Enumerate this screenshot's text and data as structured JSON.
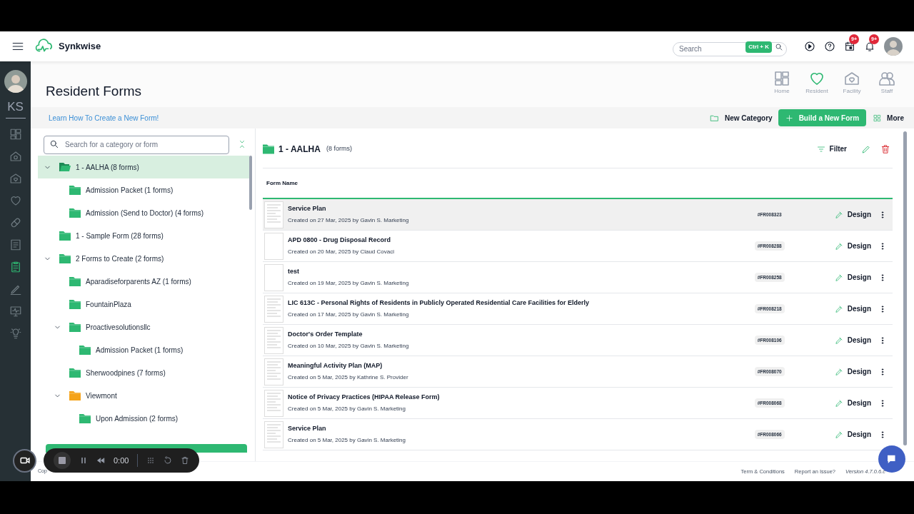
{
  "topbar": {
    "brand": "Synkwise",
    "search": {
      "placeholder": "Search",
      "shortcut": "Ctrl + K"
    },
    "badges": [
      "9+",
      "9+"
    ]
  },
  "side_nav": {
    "initials": "KS",
    "items": [
      {
        "kind": "dashboard",
        "selected": false
      },
      {
        "kind": "facility",
        "selected": false
      },
      {
        "kind": "home",
        "selected": false
      },
      {
        "kind": "heart",
        "selected": false
      },
      {
        "kind": "pill",
        "selected": false
      },
      {
        "kind": "report",
        "selected": false
      },
      {
        "kind": "clipboard",
        "selected": true
      },
      {
        "kind": "pen",
        "selected": false
      },
      {
        "kind": "monitor",
        "selected": false
      },
      {
        "kind": "bulb",
        "selected": false
      }
    ]
  },
  "page": {
    "title": "Resident Forms",
    "learn_link": "Learn How To Create a New Form!",
    "sections": [
      {
        "kind": "home",
        "label": "Home",
        "selected": false
      },
      {
        "kind": "heart",
        "label": "Resident",
        "selected": true
      },
      {
        "kind": "facility",
        "label": "Facility",
        "selected": false
      },
      {
        "kind": "staff",
        "label": "Staff",
        "selected": false
      }
    ],
    "actions": {
      "new_category": "New Category",
      "build": "Build a New Form",
      "more": "More"
    }
  },
  "tree": {
    "search": {
      "placeholder": "Search for a category or form"
    },
    "items": [
      {
        "label": "1 - AALHA (8 forms)",
        "selected": true,
        "expanded": true,
        "color": "#2eb872",
        "children": [
          {
            "label": "Admission Packet (1 forms)",
            "selected": false,
            "color": "#2eb872"
          },
          {
            "label": "Admission (Send to Doctor) (4 forms)",
            "selected": false,
            "color": "#2eb872"
          }
        ]
      },
      {
        "label": "1 - Sample Form (28 forms)",
        "selected": false,
        "color": "#2eb872"
      },
      {
        "label": "2 Forms to Create (2 forms)",
        "selected": false,
        "expanded": true,
        "color": "#2eb872",
        "children": [
          {
            "label": "Aparadiseforparents AZ (1 forms)",
            "selected": false,
            "color": "#2eb872"
          },
          {
            "label": "FountainPlaza",
            "selected": false,
            "color": "#2eb872"
          },
          {
            "label": "Proactivesolutionsllc",
            "selected": false,
            "expanded": true,
            "color": "#2eb872",
            "children": [
              {
                "label": "Admission Packet (1 forms)",
                "selected": false,
                "color": "#2eb872"
              }
            ]
          },
          {
            "label": "Sherwoodpines (7 forms)",
            "selected": false,
            "color": "#2eb872"
          },
          {
            "label": "Viewmont",
            "selected": false,
            "expanded": true,
            "color": "#f5a31a",
            "children": [
              {
                "label": "Upon Admission (2 forms)",
                "selected": false,
                "color": "#2eb872"
              }
            ]
          }
        ]
      }
    ]
  },
  "category": {
    "title": "1 - AALHA",
    "count": "(8 forms)",
    "filter": "Filter",
    "column": "Form Name",
    "rows": [
      {
        "name": "Service Plan",
        "created": "Created on 27 Mar, 2025 by Gavin S. Marketing",
        "code": "#FR008323",
        "action": "Design",
        "kind": "document",
        "highlighted": true
      },
      {
        "name": "APD 0800 - Drug Disposal Record",
        "created": "Created on 20 Mar, 2025 by Claud Covaci",
        "code": "#FR008288",
        "action": "Design",
        "kind": "blank",
        "highlighted": false
      },
      {
        "name": "test",
        "created": "Created on 19 Mar, 2025 by Gavin S. Marketing",
        "code": "#FR008258",
        "action": "Design",
        "kind": "blank",
        "highlighted": false
      },
      {
        "name": "LIC 613C - Personal Rights of Residents in Publicly Operated Residential Care Facilities for Elderly",
        "created": "Created on 17 Mar, 2025 by Gavin S. Marketing",
        "code": "#FR008218",
        "action": "Design",
        "kind": "document",
        "highlighted": false
      },
      {
        "name": "Doctor's Order Template",
        "created": "Created on 10 Mar, 2025 by Gavin S. Marketing",
        "code": "#FR008106",
        "action": "Design",
        "kind": "document",
        "highlighted": false
      },
      {
        "name": "Meaningful Activity Plan (MAP)",
        "created": "Created on 5 Mar, 2025 by Kathrine S. Provider",
        "code": "#FR008070",
        "action": "Design",
        "kind": "document",
        "highlighted": false
      },
      {
        "name": "Notice of Privacy Practices (HIPAA Release Form)",
        "created": "Created on 5 Mar, 2025 by Gavin S. Marketing",
        "code": "#FR008068",
        "action": "Design",
        "kind": "document",
        "highlighted": false
      },
      {
        "name": "Service Plan",
        "created": "Created on 5 Mar, 2025 by Gavin S. Marketing",
        "code": "#FR008066",
        "action": "Design",
        "kind": "document",
        "highlighted": false
      }
    ]
  },
  "footer": {
    "copyright": "Cop",
    "links": [
      "Term & Conditions",
      "Report an Issue?"
    ],
    "version": "Version 4.7.0.6.c"
  },
  "recorder": {
    "time": "0:00"
  }
}
